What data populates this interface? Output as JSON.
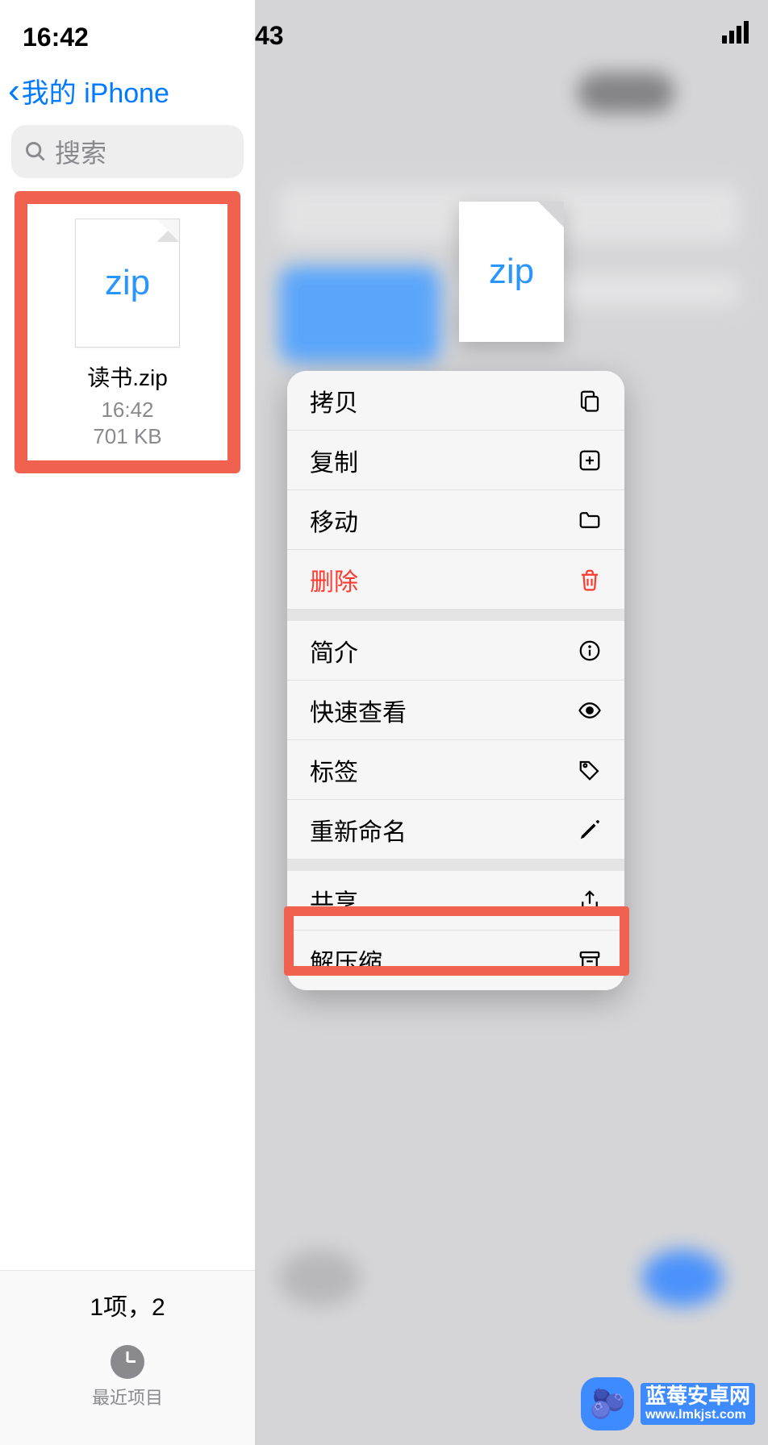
{
  "status": {
    "time_left": "16:42",
    "time_right_peek": "43"
  },
  "nav": {
    "back_title": "我的 iPhone"
  },
  "search": {
    "placeholder": "搜索"
  },
  "file": {
    "ext_label": "zip",
    "name": "读书.zip",
    "time": "16:42",
    "size": "701 KB"
  },
  "footer": {
    "count": "1项，2",
    "tab_recent": "最近项目"
  },
  "menu": {
    "copy": "拷贝",
    "duplicate": "复制",
    "move": "移动",
    "delete": "删除",
    "info": "简介",
    "quicklook": "快速查看",
    "tags": "标签",
    "rename": "重新命名",
    "share": "共享",
    "uncompress": "解压缩"
  },
  "watermark": {
    "main": "蓝莓安卓网",
    "sub": "www.lmkjst.com",
    "emoji": "🫐"
  }
}
